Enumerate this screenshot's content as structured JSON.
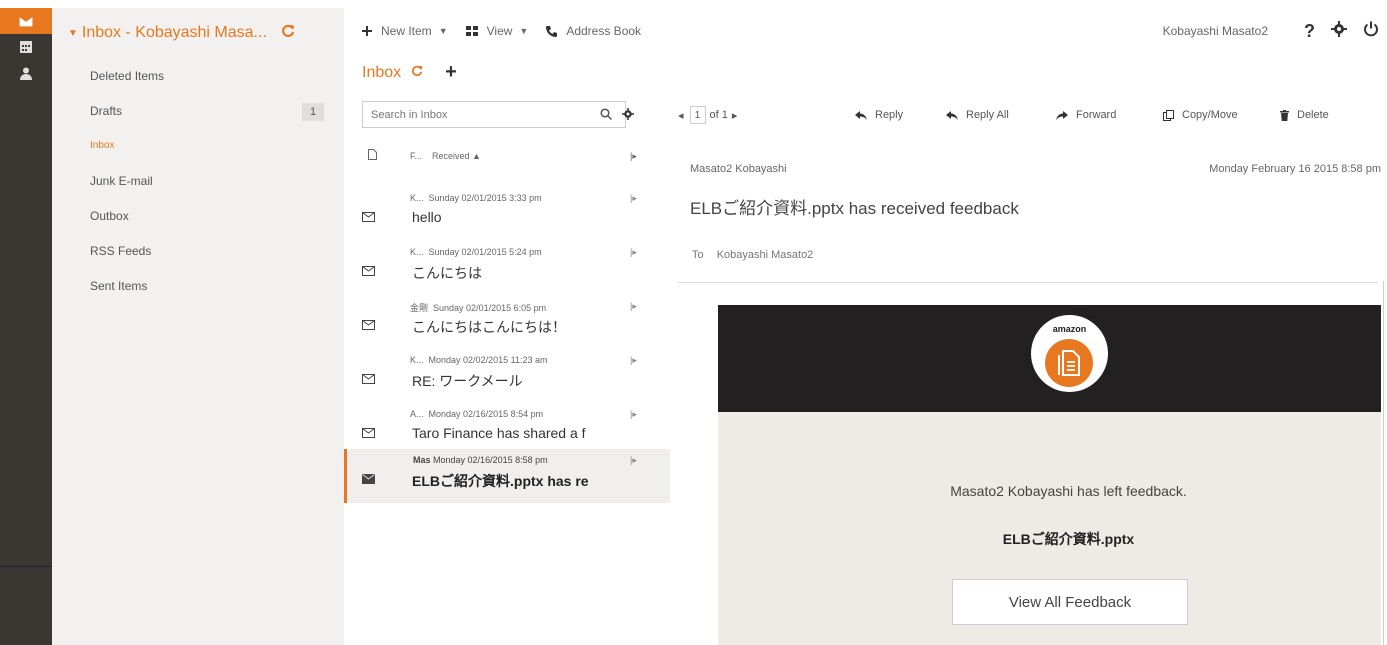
{
  "rail": {
    "icons": [
      "mail-icon",
      "calendar-icon",
      "contacts-icon"
    ]
  },
  "folders": {
    "title": "Inbox - Kobayashi Masa...",
    "items": [
      {
        "label": "Deleted Items"
      },
      {
        "label": "Drafts",
        "count": "1"
      },
      {
        "label": "Inbox"
      },
      {
        "label": "Junk E-mail"
      },
      {
        "label": "Outbox"
      },
      {
        "label": "RSS Feeds"
      },
      {
        "label": "Sent Items"
      }
    ]
  },
  "toolbar": {
    "new_item": "New Item",
    "view": "View",
    "address_book": "Address Book",
    "user": "Kobayashi Masato2"
  },
  "tabs": {
    "inbox": "Inbox"
  },
  "list": {
    "search_placeholder": "Search in Inbox",
    "header_from": "F...",
    "header_received": "Received",
    "messages": [
      {
        "sender": "K...",
        "date": "Sunday 02/01/2015 3:33 pm",
        "subject": "hello"
      },
      {
        "sender": "K...",
        "date": "Sunday 02/01/2015 5:24 pm",
        "subject": "こんにちは"
      },
      {
        "sender": "金剛",
        "date": "Sunday 02/01/2015 6:05 pm",
        "subject": "こんにちはこんにちは！"
      },
      {
        "sender": "K...",
        "date": "Monday 02/02/2015 11:23 am",
        "subject": "RE: ワークメール"
      },
      {
        "sender": "A...",
        "date": "Monday 02/16/2015 8:54 pm",
        "subject": "Taro Finance has shared a f"
      },
      {
        "sender": "Mas",
        "date": "Monday 02/16/2015 8:58 pm",
        "subject": "ELBご紹介資料.pptx has re"
      }
    ]
  },
  "reading": {
    "page_current": "1",
    "page_total": "of 1",
    "actions": {
      "reply": "Reply",
      "reply_all": "Reply All",
      "forward": "Forward",
      "copy_move": "Copy/Move",
      "delete": "Delete"
    },
    "from": "Masato2 Kobayashi",
    "date": "Monday February 16 2015 8:58 pm",
    "subject": "ELBご紹介資料.pptx has received feedback",
    "to_label": "To",
    "to": "Kobayashi Masato2",
    "body": {
      "logo_word": "amazon",
      "feedback_text": "Masato2 Kobayashi has left feedback.",
      "file_name": "ELBご紹介資料.pptx",
      "button": "View All Feedback"
    }
  },
  "colors": {
    "accent": "#e8781f",
    "rail": "#3a3632",
    "banner": "#232021"
  }
}
